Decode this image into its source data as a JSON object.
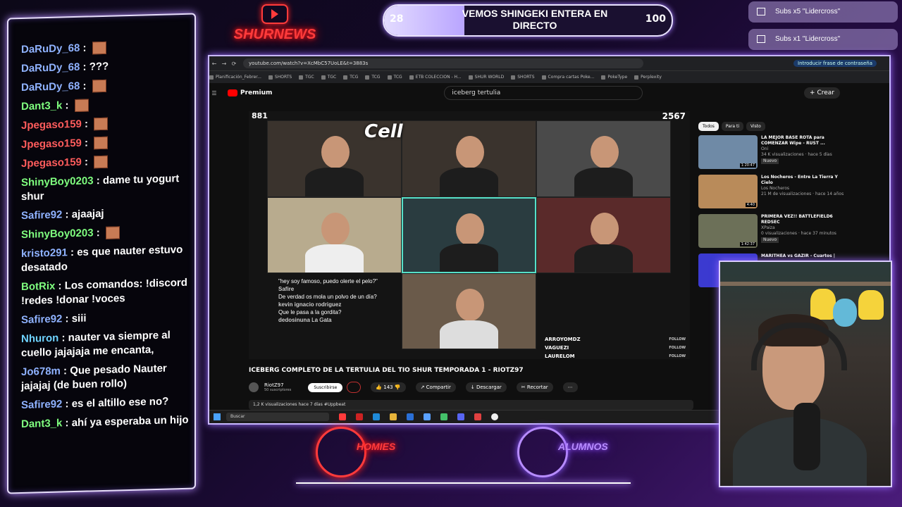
{
  "overlay": {
    "logo_text": "SHURNEWS",
    "goal": {
      "current": "28",
      "title": "VEMOS SHINGEKI ENTERA EN DIRECTO",
      "target": "100",
      "fill_fraction": 0.28
    },
    "alerts": [
      "Subs x5 \"Lidercross\"",
      "Subs x1 \"Lidercross\""
    ],
    "teams": {
      "left": "HOMIES",
      "right": "ALUMNOS"
    }
  },
  "chat": {
    "messages": [
      {
        "user": "DaRuDy_68",
        "text": "",
        "style": "blue"
      },
      {
        "user": "DaRuDy_68",
        "text": "???",
        "style": "blue"
      },
      {
        "user": "DaRuDy_68",
        "text": "",
        "style": "blue"
      },
      {
        "user": "Dant3_k",
        "text": "",
        "style": "green"
      },
      {
        "user": "Jpegaso159",
        "text": "",
        "style": "red"
      },
      {
        "user": "Jpegaso159",
        "text": "",
        "style": "red"
      },
      {
        "user": "Jpegaso159",
        "text": "",
        "style": "red"
      },
      {
        "user": "ShinyBoy0203",
        "text": "dame tu yogurt shur",
        "style": "green"
      },
      {
        "user": "Safire92",
        "text": "ajaajaj",
        "style": "blue"
      },
      {
        "user": "ShinyBoy0203",
        "text": "",
        "style": "green"
      },
      {
        "user": "kristo291",
        "text": "es que nauter estuvo desatado",
        "style": "blue"
      },
      {
        "user": "BotRix",
        "text": "Los comandos: !discord !redes !donar !voces",
        "style": "green"
      },
      {
        "user": "Safire92",
        "text": "siii",
        "style": "blue"
      },
      {
        "user": "Nhuron",
        "text": "nauter va siempre al cuello jajajaja me encanta,",
        "style": "sky"
      },
      {
        "user": "Jo678m",
        "text": "Que pesado Nauter jajajaj (de buen rollo)",
        "style": "blue"
      },
      {
        "user": "Safire92",
        "text": "es el altillo ese no?",
        "style": "blue"
      },
      {
        "user": "Dant3_k",
        "text": "ahí ya esperaba un hijo",
        "style": "green"
      }
    ]
  },
  "browser": {
    "url": "youtube.com/watch?v=XcMbC57UoLE&t=3883s",
    "password_chip": "Introducir frase de contraseña",
    "bookmarks": [
      "Planificación_Febrer...",
      "SHORTS",
      "TGC",
      "TGC",
      "TCG",
      "TCG",
      "TCG",
      "ETB COLECCION - H...",
      "SHUR WORLD",
      "SHORTS",
      "Compra cartas Poke...",
      "PokeType",
      "Perplexity"
    ],
    "yt_brand": "Premium",
    "search_query": "iceberg tertulia",
    "create_label": "+ Crear",
    "video": {
      "left_count": "881",
      "right_count": "2567",
      "cam_tag": "Cell",
      "mini_chat": [
        {
          "user": "",
          "text": "\"hey soy famoso, puedo olerte el pelo?\""
        },
        {
          "user": "Safire",
          "text": ""
        },
        {
          "user": "",
          "text": "De verdad os mola un polvo de un día?"
        },
        {
          "user": "kevin ignacio rodriguez",
          "text": ""
        },
        {
          "user": "",
          "text": "Que le pasa a la gordita?"
        },
        {
          "user": "dedosinuna",
          "text": "La Gata"
        }
      ],
      "follows": [
        {
          "name": "ARROYOMDZ",
          "action": "FOLLOW"
        },
        {
          "name": "VAGUEZI",
          "action": "FOLLOW"
        },
        {
          "name": "LAURELOM",
          "action": "FOLLOW"
        }
      ]
    },
    "title": "ICEBERG COMPLETO DE LA TERTULIA DEL TIO SHUR TEMPORADA 1 - RIOTZ97",
    "channel": {
      "name": "RiotZ97",
      "subs": "50 suscriptores",
      "subscribe": "Suscribirse"
    },
    "actions": {
      "likes": "143",
      "share": "Compartir",
      "download": "Descargar",
      "clip": "Recortar"
    },
    "description": "1,2 K visualizaciones  hace 7 días  #Uppbeat",
    "chips": [
      "Todos",
      "Para ti",
      "Visto"
    ],
    "recommendations": [
      {
        "title": "LA MEJOR BASE ROTA para COMENZAR Wipe - RUST ...",
        "channel": "Oni",
        "meta": "34 K visualizaciones · hace 5 días",
        "badge": "Nuevo",
        "duration": "1:20:47",
        "thumb": "#6f8aa6"
      },
      {
        "title": "Los Nocheros - Entre La Tierra Y Cielo",
        "channel": "Los Nocheros",
        "meta": "21 M de visualizaciones · hace 14 años",
        "badge": "",
        "duration": "4:40",
        "thumb": "#b98b5a"
      },
      {
        "title": "PRIMERA VEZ!! BATTLEFIELD6 REDSEC",
        "channel": "XPaiza",
        "meta": "0 visualizaciones · hace 37 minutos",
        "badge": "Nuevo",
        "duration": "1:42:37",
        "thumb": "#6c7058"
      },
      {
        "title": "MARITHEA vs GAZIR - Cuartos |",
        "channel": "",
        "meta": "",
        "badge": "",
        "duration": "",
        "thumb": "#3b3ad0"
      }
    ],
    "taskbar_search": "Buscar"
  }
}
